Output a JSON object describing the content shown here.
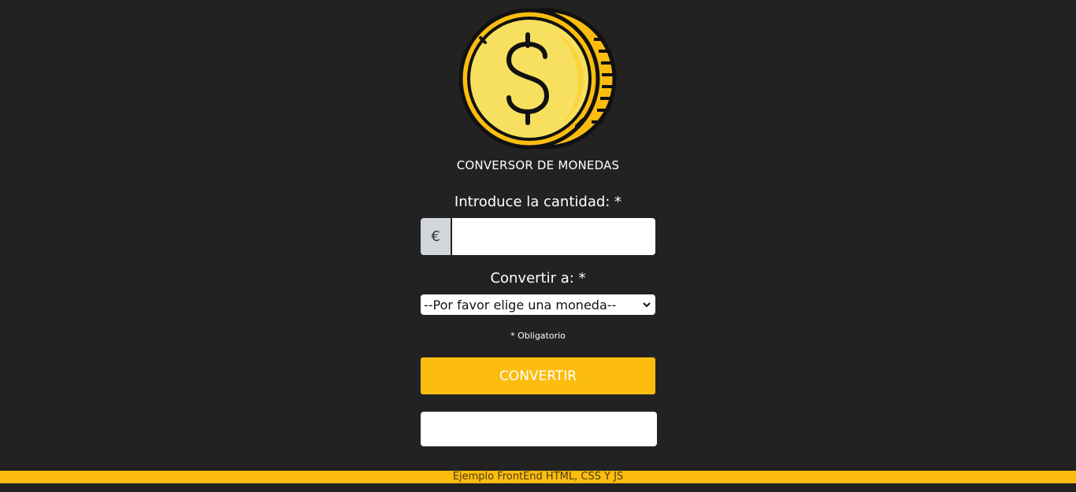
{
  "header": {
    "logo_icon": "dollar-coin-icon",
    "title": "CONVERSOR DE MONEDAS"
  },
  "form": {
    "amount_label": "Introduce la cantidad: *",
    "currency_symbol": "€",
    "amount_value": "",
    "convert_to_label": "Convertir a: *",
    "currency_select_value": "--Por favor elige una moneda--",
    "required_note": "* Obligatorio",
    "convert_button_label": "CONVERTIR",
    "result_value": ""
  },
  "footer": {
    "text": "Ejemplo FrontEnd HTML, CSS Y JS"
  },
  "colors": {
    "background": "#222222",
    "accent": "#fcbd0f",
    "coin_face": "#f7e05f",
    "coin_outline": "#111111"
  }
}
